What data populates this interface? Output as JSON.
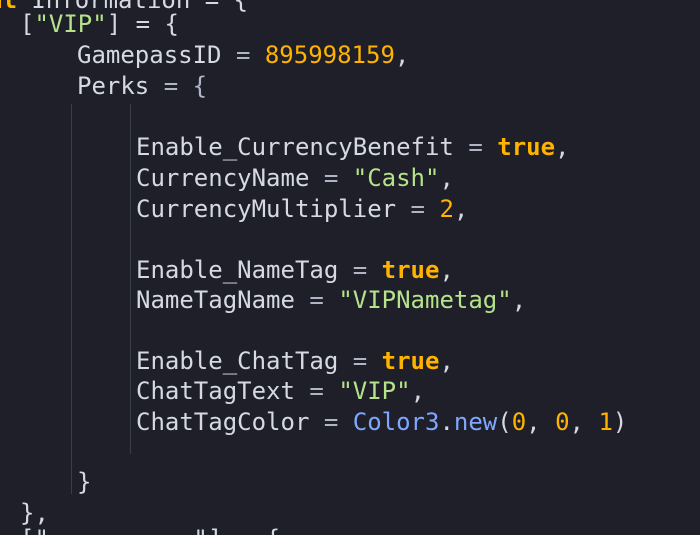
{
  "code": {
    "partial_top": {
      "keyword": "al",
      "rest": " Information = {"
    },
    "vip_key": {
      "open": "[",
      "str": "\"VIP\"",
      "close": "] = {"
    },
    "gamepass": {
      "name": "GamepassID",
      "eq": " = ",
      "value": "895998159",
      "comma": ","
    },
    "perks": {
      "name": "Perks",
      "eq": " = {"
    },
    "currency_benefit": {
      "name": "Enable_CurrencyBenefit",
      "eq": " = ",
      "value": "true",
      "comma": ","
    },
    "currency_name": {
      "name": "CurrencyName",
      "eq": " = ",
      "value": "\"Cash\"",
      "comma": ","
    },
    "currency_mult": {
      "name": "CurrencyMultiplier",
      "eq": " = ",
      "value": "2",
      "comma": ","
    },
    "nametag_enable": {
      "name": "Enable_NameTag",
      "eq": " = ",
      "value": "true",
      "comma": ","
    },
    "nametag_name": {
      "name": "NameTagName",
      "eq": " = ",
      "value": "\"VIPNametag\"",
      "comma": ","
    },
    "chattag_enable": {
      "name": "Enable_ChatTag",
      "eq": " = ",
      "value": "true",
      "comma": ","
    },
    "chattag_text": {
      "name": "ChatTagText",
      "eq": " = ",
      "value": "\"VIP\"",
      "comma": ","
    },
    "chattag_color": {
      "name": "ChatTagColor",
      "eq": " = ",
      "type": "Color3",
      "dot": ".",
      "fn": "new",
      "open": "(",
      "a": "0",
      "sep1": ", ",
      "b": "0",
      "sep2": ", ",
      "c": "1",
      "close": ")"
    },
    "perks_close": "}",
    "vip_close": "},",
    "partial_bottom": "[\"          \"] = {"
  }
}
